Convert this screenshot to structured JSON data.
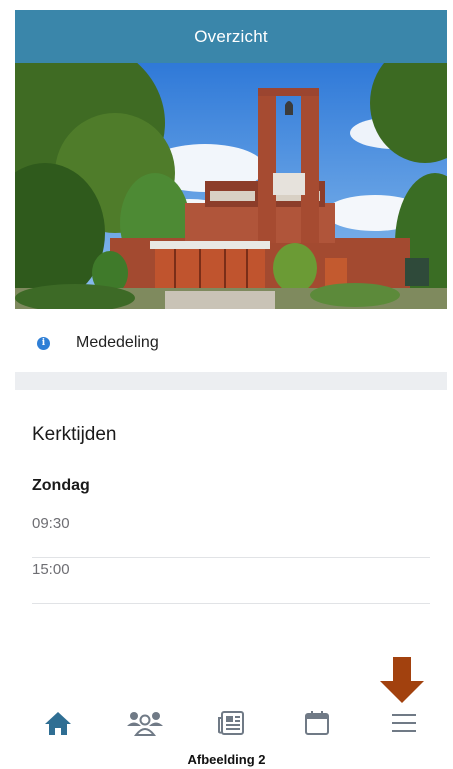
{
  "header": {
    "title": "Overzicht"
  },
  "hero": {
    "alt": "church building photo"
  },
  "notice": {
    "icon": "info-icon",
    "label": "Mededeling"
  },
  "church_times": {
    "title": "Kerktijden",
    "day": "Zondag",
    "times": [
      "09:30",
      "15:00"
    ]
  },
  "tabbar": {
    "tabs": [
      {
        "icon": "home-icon",
        "active": true
      },
      {
        "icon": "people-icon",
        "active": false
      },
      {
        "icon": "newspaper-icon",
        "active": false
      },
      {
        "icon": "calendar-icon",
        "active": false
      },
      {
        "icon": "menu-icon",
        "active": false
      }
    ]
  },
  "annotation": {
    "arrow_color": "#a2410e"
  },
  "caption": "Afbeelding 2",
  "colors": {
    "header": "#3a86aa",
    "active_tab": "#2f6e93",
    "inactive_tab": "#707a86"
  }
}
